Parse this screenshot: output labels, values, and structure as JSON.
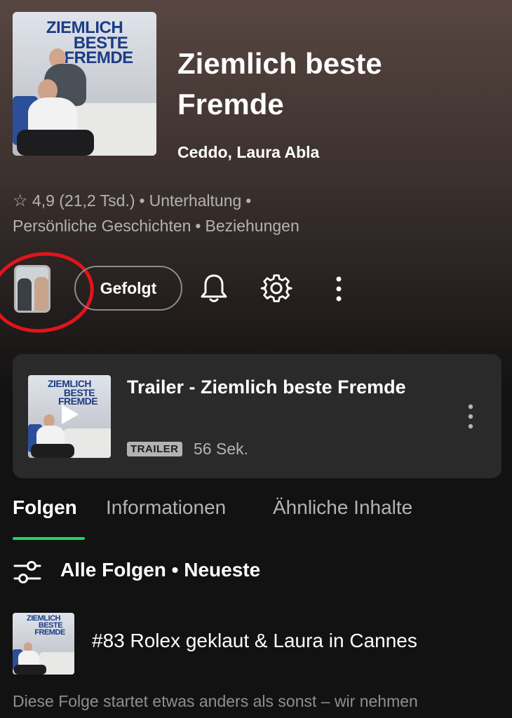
{
  "podcast": {
    "title": "Ziemlich beste Fremde",
    "authors": "Ceddo, Laura Abla",
    "rating": "4,9",
    "rating_count": "(21,2 Tsd.)",
    "categories_line1": [
      "Unterhaltung"
    ],
    "categories_line2": [
      "Persönliche Geschichten",
      "Beziehungen"
    ],
    "cover_text": [
      "ZIEMLICH",
      "BESTE",
      "FREMDE"
    ]
  },
  "actions": {
    "follow_label": "Gefolgt",
    "icons": [
      "thumbnail-image",
      "bell-icon",
      "gear-icon",
      "more-vertical-icon"
    ]
  },
  "trailer": {
    "title": "Trailer - Ziemlich beste Fremde",
    "badge": "TRAILER",
    "duration": "56 Sek."
  },
  "tabs": [
    {
      "label": "Folgen",
      "active": true
    },
    {
      "label": "Informationen",
      "active": false
    },
    {
      "label": "Ähnliche Inhalte",
      "active": false
    }
  ],
  "filter": {
    "label": "Alle Folgen • Neueste"
  },
  "episode": {
    "title": "#83 Rolex geklaut & Laura in Cannes",
    "description": "Diese Folge startet etwas anders als sonst – wir nehmen"
  },
  "colors": {
    "accent": "#1ed760",
    "highlight_circle": "#e3141a",
    "background": "#121212",
    "card": "#2a2a2a"
  }
}
